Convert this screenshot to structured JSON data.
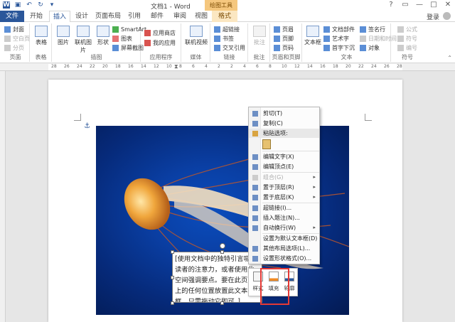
{
  "window": {
    "title": "文档1 - Word",
    "contextual_tab_header": "绘图工具",
    "help": "?",
    "sign_in": "登录"
  },
  "tabs": [
    "文件",
    "开始",
    "插入",
    "设计",
    "页面布局",
    "引用",
    "邮件",
    "审阅",
    "视图",
    "格式"
  ],
  "active_tab": "插入",
  "ribbon": {
    "pages": {
      "items": [
        "封面",
        "空白页",
        "分页"
      ],
      "label": "页面"
    },
    "tables": {
      "button": "表格",
      "label": "表格"
    },
    "illustrations": {
      "picture": "图片",
      "online_picture": "联机图片",
      "shapes": "形状",
      "smartart": "SmartArt",
      "chart": "图表",
      "screenshot": "屏幕截图",
      "label": "插图"
    },
    "apps": {
      "store": "应用商店",
      "my_apps": "我的应用",
      "label": "应用程序"
    },
    "media": {
      "online_video": "联机视频",
      "label": "媒体"
    },
    "links": {
      "hyperlink": "超链接",
      "bookmark": "书签",
      "cross_reference": "交叉引用",
      "label": "链接"
    },
    "comments": {
      "comment": "批注",
      "label": "批注"
    },
    "header_footer": {
      "header": "页眉",
      "footer": "页脚",
      "page_number": "页码",
      "label": "页眉和页脚"
    },
    "text": {
      "textbox": "文本框",
      "quick_parts": "文档部件",
      "wordart": "艺术字",
      "dropcap": "首字下沉",
      "signature": "签名行",
      "datetime": "日期和时间",
      "object": "对象",
      "label": "文本"
    },
    "symbols": {
      "equation": "公式",
      "symbol": "符号",
      "number": "编号",
      "label": "符号"
    }
  },
  "ruler_numbers": [
    "28",
    "26",
    "24",
    "22",
    "20",
    "18",
    "16",
    "14",
    "12",
    "10",
    "8",
    "6",
    "4",
    "2",
    "2",
    "4",
    "6",
    "8",
    "10",
    "12",
    "14",
    "16",
    "18",
    "20",
    "22",
    "24",
    "26",
    "28"
  ],
  "textbox": {
    "text": "[使用文档中的独特引言吸引读者的注意力，或者使用此空间强调要点。要在此页面上的任何位置放置此文本框，只需拖动它即可。]"
  },
  "context_menu": {
    "items": [
      {
        "label": "剪切(T)",
        "icon": "cut-icon"
      },
      {
        "label": "复制(C)",
        "icon": "copy-icon"
      },
      {
        "label": "粘贴选项:",
        "icon": "paste-icon"
      },
      {
        "label": "编辑文字(X)",
        "icon": "edit-text-icon"
      },
      {
        "label": "编辑顶点(E)",
        "icon": "edit-points-icon"
      },
      {
        "label": "组合(G)",
        "icon": "group-icon"
      },
      {
        "label": "置于顶层(R)",
        "icon": "bring-front-icon"
      },
      {
        "label": "置于底层(K)",
        "icon": "send-back-icon"
      },
      {
        "label": "超链接(I)...",
        "icon": "hyperlink-icon"
      },
      {
        "label": "插入题注(N)...",
        "icon": "caption-icon"
      },
      {
        "label": "自动换行(W)",
        "icon": "wrap-icon"
      },
      {
        "label": "设置为默认文本框(D)",
        "icon": ""
      },
      {
        "label": "其他布局选项(L)...",
        "icon": "layout-icon"
      },
      {
        "label": "设置形状格式(O)...",
        "icon": "format-shape-icon"
      }
    ]
  },
  "mini_toolbar": {
    "style": "样式",
    "fill": "填充",
    "outline": "轮廓"
  },
  "colors": {
    "accent": "#2b579a",
    "format_tab": "#fbe7c2",
    "highlight": "#e53935"
  }
}
